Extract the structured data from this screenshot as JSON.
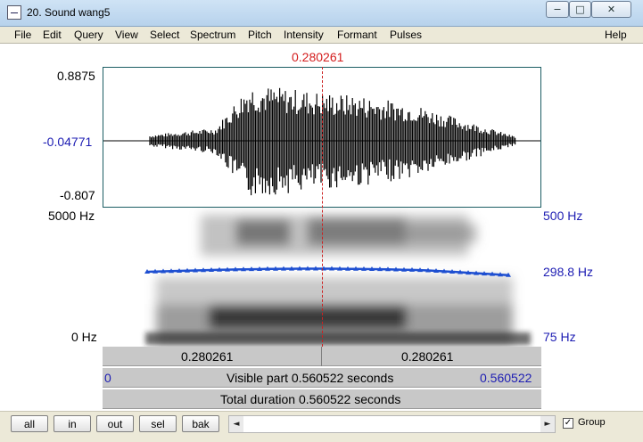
{
  "window": {
    "title": "20. Sound wang5",
    "buttons": {
      "minimize": "−",
      "maximize": "□",
      "close": "✕"
    }
  },
  "menu": [
    "File",
    "Edit",
    "Query",
    "View",
    "Select",
    "Spectrum",
    "Pitch",
    "Intensity",
    "Formant",
    "Pulses",
    "Help"
  ],
  "cursor_time": "0.280261",
  "wave": {
    "top_label": "0.8875",
    "mid_label": "-0.04771",
    "bottom_label": "-0.807"
  },
  "spectrogram": {
    "top_left_label": "5000 Hz",
    "bottom_left_label": "0 Hz"
  },
  "pitch": {
    "top_label": "500 Hz",
    "mid_label": "298.8 Hz",
    "bottom_label": "75 Hz",
    "line_color": "#1e4fd1"
  },
  "time_bars": {
    "left_segment": "0.280261",
    "right_segment": "0.280261",
    "visible_start": "0",
    "visible_text": "Visible part 0.560522 seconds",
    "visible_end": "0.560522",
    "total_text": "Total duration 0.560522 seconds"
  },
  "toolbar": {
    "buttons": [
      "all",
      "in",
      "out",
      "sel",
      "bak"
    ],
    "scroll_left": "◄",
    "scroll_right": "►",
    "group_checked": "✓",
    "group_label": "Group"
  },
  "colors": {
    "cursor": "#d41c1c",
    "axis_blue": "#1d1db3",
    "wave_border": "#1b5d63"
  }
}
